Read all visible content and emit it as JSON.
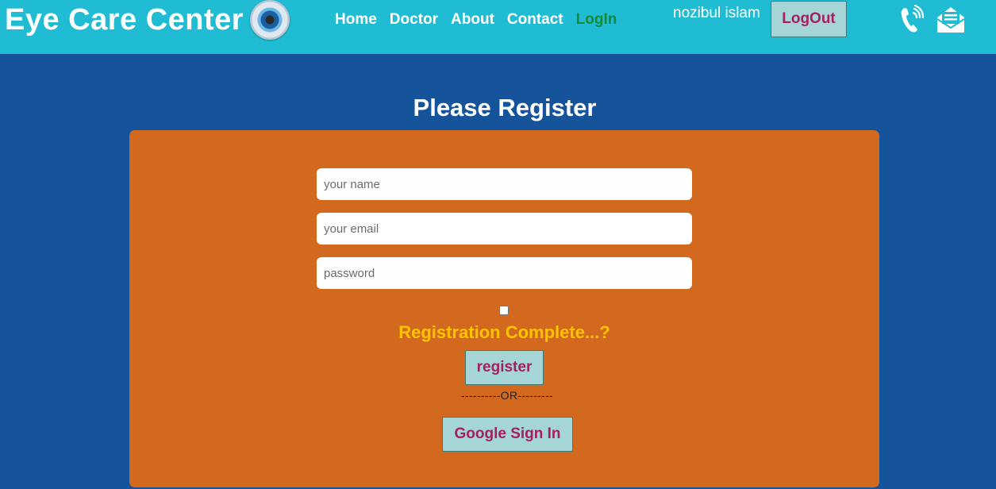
{
  "navbar": {
    "brand_title": "Eye Care Center",
    "logo_icon": "eye-icon",
    "links": [
      {
        "label": "Home"
      },
      {
        "label": "Doctor"
      },
      {
        "label": "About"
      },
      {
        "label": "Contact"
      },
      {
        "label": "LogIn",
        "active": true
      }
    ],
    "username": "nozibul islam",
    "logout_label": "LogOut",
    "icons": [
      "phone-icon",
      "mail-icon"
    ]
  },
  "page_title": "Please Register",
  "form": {
    "name_placeholder": "your name",
    "email_placeholder": "your email",
    "password_placeholder": "password",
    "name_value": "",
    "email_value": "",
    "password_value": "",
    "checkbox_checked": false,
    "question": "Registration Complete...?",
    "register_label": "register",
    "divider_text": "----------OR---------",
    "google_label": "Google Sign In"
  },
  "colors": {
    "navbar_bg": "#20bcd4",
    "page_bg": "#15549b",
    "card_bg": "#d2691e",
    "button_bg": "#a5d5d7",
    "button_text": "#a4205e",
    "question_text": "#ffc400",
    "active_link": "#138a3a"
  }
}
